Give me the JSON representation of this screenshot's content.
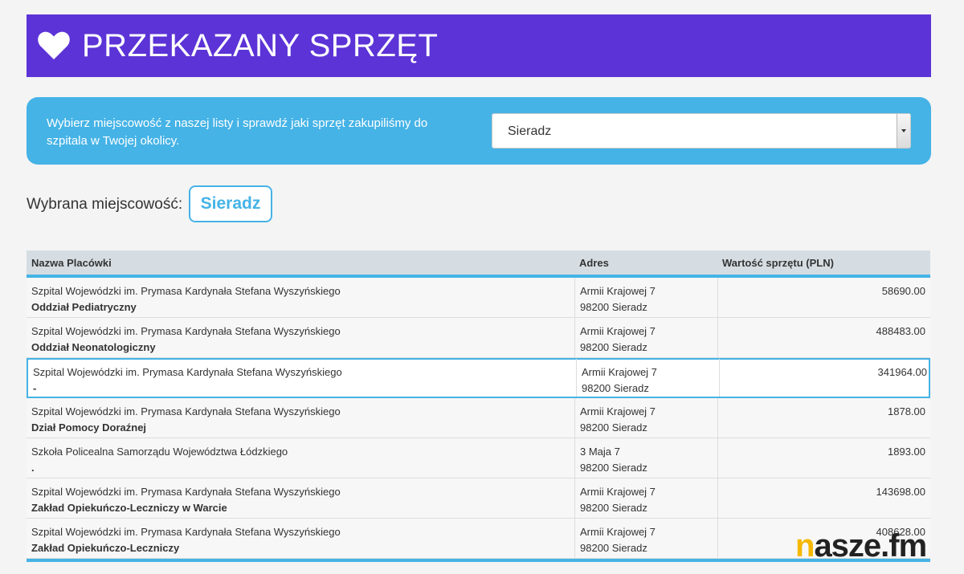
{
  "banner": {
    "title": "PRZEKAZANY SPRZĘT",
    "icon": "heart-icon"
  },
  "selector": {
    "description": "Wybierz miejscowość z naszej listy i sprawdź jaki sprzęt zakupiliśmy do szpitala w Twojej okolicy.",
    "selected_value": "Sieradz"
  },
  "chosen": {
    "label": "Wybrana miejscowość:",
    "value": "Sieradz"
  },
  "table": {
    "columns": {
      "name": "Nazwa Placówki",
      "address": "Adres",
      "value": "Wartość sprzętu (PLN)"
    },
    "rows": [
      {
        "institution": "Szpital Wojewódzki im. Prymasa Kardynała Stefana Wyszyńskiego",
        "unit": "Oddział Pediatryczny",
        "street": "Armii Krajowej 7",
        "city": "98200 Sieradz",
        "value": "58690.00"
      },
      {
        "institution": "Szpital Wojewódzki im. Prymasa Kardynała Stefana Wyszyńskiego",
        "unit": "Oddział Neonatologiczny",
        "street": "Armii Krajowej 7",
        "city": "98200 Sieradz",
        "value": "488483.00"
      },
      {
        "institution": "Szpital Wojewódzki im. Prymasa Kardynała Stefana Wyszyńskiego",
        "unit": "-",
        "street": "Armii Krajowej 7",
        "city": "98200 Sieradz",
        "value": "341964.00"
      },
      {
        "institution": "Szpital Wojewódzki im. Prymasa Kardynała Stefana Wyszyńskiego",
        "unit": "Dział Pomocy Doraźnej",
        "street": "Armii Krajowej 7",
        "city": "98200 Sieradz",
        "value": "1878.00"
      },
      {
        "institution": "Szkoła Policealna Samorządu Województwa Łódzkiego",
        "unit": ".",
        "street": "3 Maja 7",
        "city": "98200 Sieradz",
        "value": "1893.00"
      },
      {
        "institution": "Szpital Wojewódzki im. Prymasa Kardynała Stefana Wyszyńskiego",
        "unit": "Zakład Opiekuńczo-Leczniczy w Warcie",
        "street": "Armii Krajowej 7",
        "city": "98200 Sieradz",
        "value": "143698.00"
      },
      {
        "institution": "Szpital Wojewódzki im. Prymasa Kardynała Stefana Wyszyńskiego",
        "unit": "Zakład Opiekuńczo-Leczniczy",
        "street": "Armii Krajowej 7",
        "city": "98200 Sieradz",
        "value": "408628.00"
      }
    ]
  },
  "watermark": {
    "first": "n",
    "rest": "asze.fm"
  },
  "colors": {
    "banner": "#5c33d6",
    "accent": "#45b3e6",
    "watermark_accent": "#f5b800"
  }
}
